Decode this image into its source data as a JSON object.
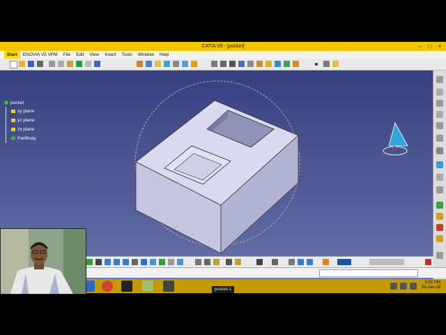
{
  "window": {
    "title": "CATIA V5 - [pocket]"
  },
  "menu": [
    "Start",
    "ENOVIA V5 VPM",
    "File",
    "Edit",
    "View",
    "Insert",
    "Tools",
    "Window",
    "Help"
  ],
  "tree": {
    "root": "pocket",
    "items": [
      "xy plane",
      "yz plane",
      "zx plane",
      "PartBody"
    ]
  },
  "taskbar": {
    "active_label": "pocket-1",
    "time": "6:02 PM",
    "date": "09-Jan-18"
  },
  "colors": {
    "titlebar": "#f5c400",
    "taskbar": "#c49a00",
    "viewport_top": "#36407f",
    "viewport_bottom": "#6e78ae"
  }
}
